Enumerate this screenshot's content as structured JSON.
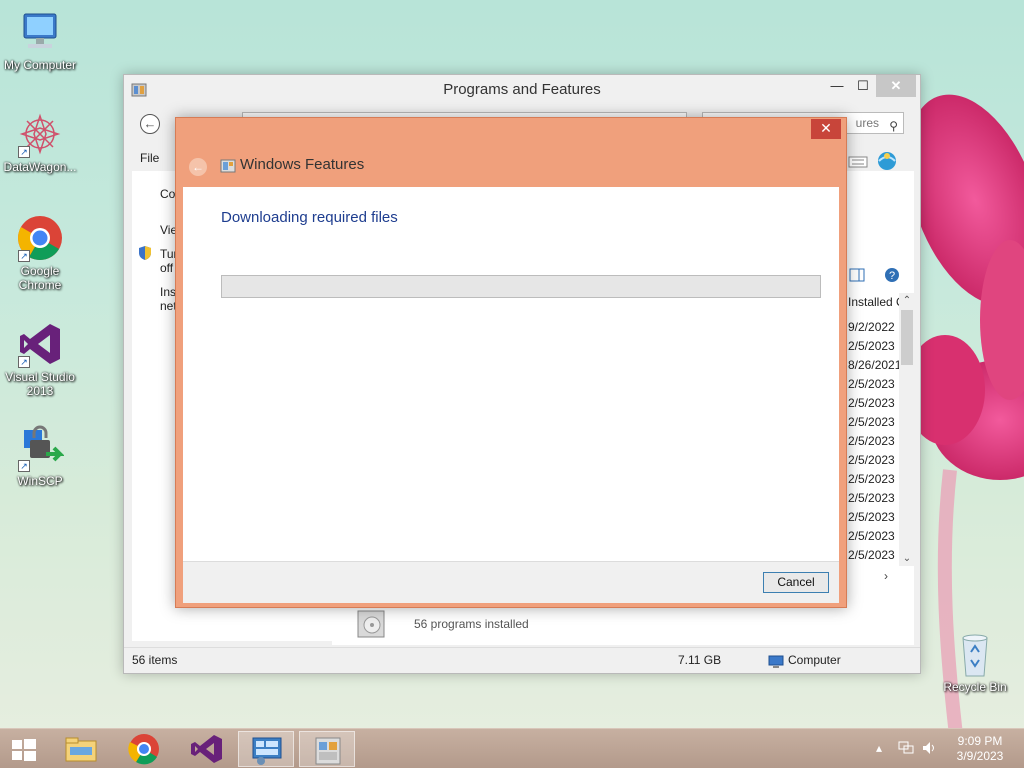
{
  "desktop": {
    "icons": [
      {
        "label_line1": "My Computer",
        "label_line2": ""
      },
      {
        "label_line1": "DataWagon...",
        "label_line2": ""
      },
      {
        "label_line1": "Google",
        "label_line2": "Chrome"
      },
      {
        "label_line1": "Visual Studio",
        "label_line2": "2013"
      },
      {
        "label_line1": "WinSCP",
        "label_line2": ""
      },
      {
        "label_line1": "Recycle Bin",
        "label_line2": ""
      }
    ]
  },
  "programs_window": {
    "title": "Programs and Features",
    "search_placeholder_fragment": "ures",
    "menu_file": "File",
    "left_items": [
      "Co",
      "Vie",
      "Tur",
      "off",
      "Inst",
      "net"
    ],
    "column_header": "Installed O",
    "install_dates": [
      "9/2/2022",
      "2/5/2023",
      "8/26/2021",
      "2/5/2023",
      "2/5/2023",
      "2/5/2023",
      "2/5/2023",
      "2/5/2023",
      "2/5/2023",
      "2/5/2023",
      "2/5/2023",
      "2/5/2023",
      "2/5/2023"
    ],
    "programs_installed_text": "56 programs installed",
    "status": {
      "items": "56 items",
      "size": "7.11 GB",
      "location": "Computer"
    }
  },
  "windows_features_dialog": {
    "title": "Windows Features",
    "heading": "Downloading required files",
    "progress_percent": 0,
    "cancel_label": "Cancel"
  },
  "taskbar": {
    "time": "9:09 PM",
    "date": "3/9/2023"
  },
  "colors": {
    "dialog_accent": "#f0a07c",
    "heading_blue": "#1e3d8f",
    "taskbar": "#b39a8b"
  }
}
